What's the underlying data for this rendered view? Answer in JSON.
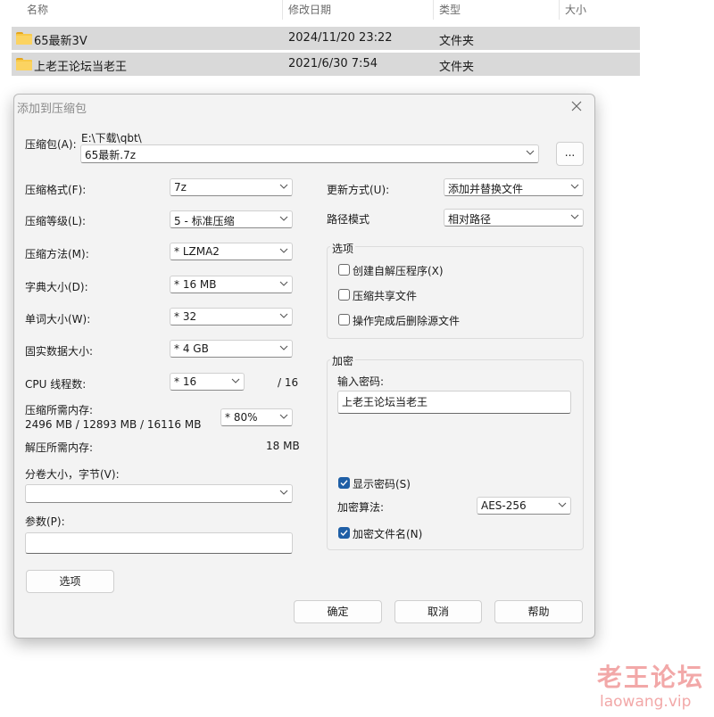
{
  "explorer": {
    "columns": {
      "name": "名称",
      "modified": "修改日期",
      "type": "类型",
      "size": "大小"
    },
    "rows": [
      {
        "name": "65最新3V",
        "modified": "2024/11/20 23:22",
        "type": "文件夹"
      },
      {
        "name": "上老王论坛当老王",
        "modified": "2021/6/30 7:54",
        "type": "文件夹"
      }
    ]
  },
  "dialog": {
    "title": "添加到压缩包",
    "archive": {
      "label": "压缩包(A):",
      "path": "E:\\下载\\qbt\\",
      "value": "65最新.7z",
      "browse_label": "..."
    },
    "format": {
      "label": "压缩格式(F):",
      "value": "7z"
    },
    "level": {
      "label": "压缩等级(L):",
      "value": "5 - 标准压缩"
    },
    "method": {
      "label": "压缩方法(M):",
      "value": "*  LZMA2"
    },
    "dict": {
      "label": "字典大小(D):",
      "value": "*  16 MB"
    },
    "word": {
      "label": "单词大小(W):",
      "value": "*  32"
    },
    "solid": {
      "label": "固实数据大小:",
      "value": "*  4 GB"
    },
    "cpu": {
      "label": "CPU 线程数:",
      "value": "*  16",
      "max": "/ 16"
    },
    "mem": {
      "label": "压缩所需内存:",
      "detail": "2496 MB / 12893 MB / 16116 MB",
      "value": "*  80%"
    },
    "demem": {
      "label": "解压所需内存:",
      "value": "18 MB"
    },
    "split": {
      "label": "分卷大小，字节(V):",
      "value": ""
    },
    "params": {
      "label": "参数(P):",
      "value": ""
    },
    "options_button": "选项",
    "update": {
      "label": "更新方式(U):",
      "value": "添加并替换文件"
    },
    "pathmode": {
      "label": "路径模式",
      "value": "相对路径"
    },
    "options_group": {
      "title": "选项",
      "items": [
        {
          "label": "创建自解压程序(X)",
          "checked": false
        },
        {
          "label": "压缩共享文件",
          "checked": false
        },
        {
          "label": "操作完成后删除源文件",
          "checked": false
        }
      ]
    },
    "encryption": {
      "title": "加密",
      "password_label": "输入密码:",
      "password": "上老王论坛当老王",
      "show_password": {
        "label": "显示密码(S)",
        "checked": true
      },
      "algorithm_label": "加密算法:",
      "algorithm": "AES-256",
      "encrypt_names": {
        "label": "加密文件名(N)",
        "checked": true
      }
    },
    "buttons": {
      "ok": "确定",
      "cancel": "取消",
      "help": "帮助"
    }
  },
  "watermark": {
    "text": "老王论坛",
    "url": "laowang.vip"
  }
}
